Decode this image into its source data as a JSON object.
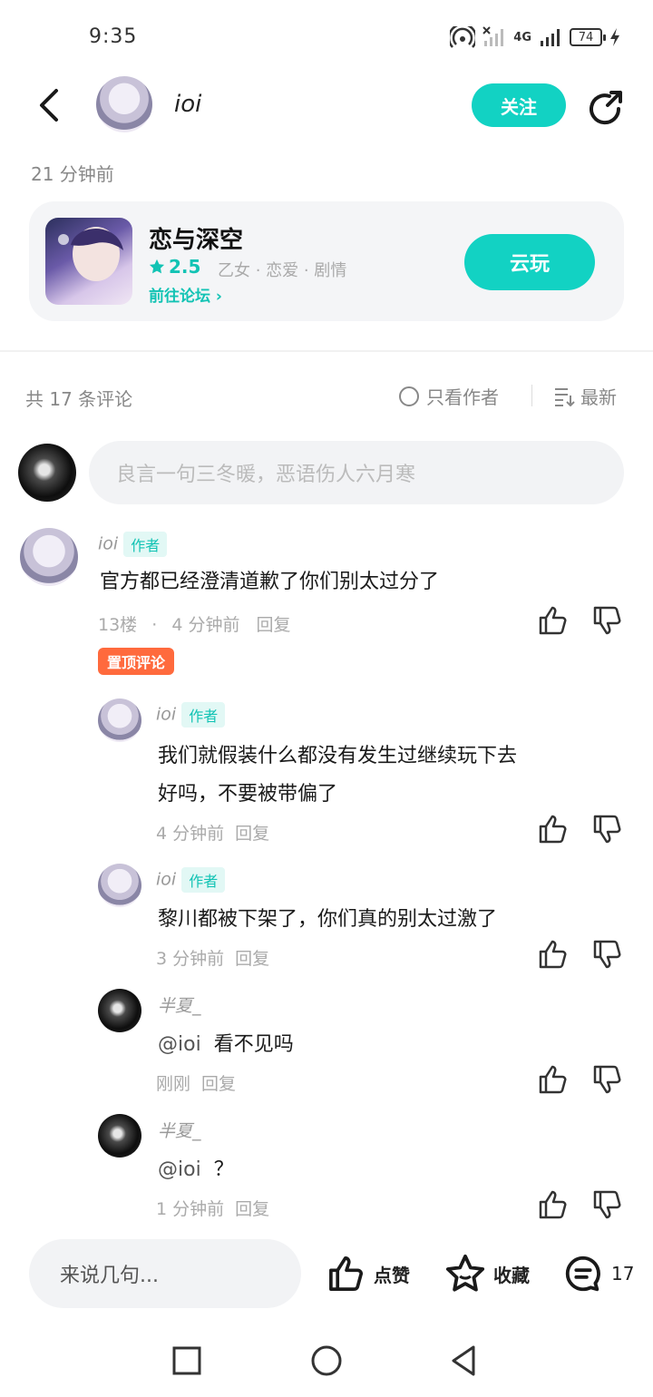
{
  "status": {
    "time": "9:35",
    "network": "4G",
    "battery": "74"
  },
  "header": {
    "user_name": "ioi",
    "follow_label": "关注"
  },
  "post": {
    "time": "21 分钟前"
  },
  "game": {
    "name": "恋与深空",
    "rating": "2.5",
    "tags": "乙女 · 恋爱 · 剧情",
    "forum_link": "前往论坛",
    "play_label": "云玩"
  },
  "comments_header": {
    "count": "共 17 条评论",
    "author_only": "只看作者",
    "sort": "最新"
  },
  "input": {
    "placeholder": "良言一句三冬暖，恶语伤人六月寒"
  },
  "author_tag": "作者",
  "top_comment": {
    "name": "ioi",
    "text": "官方都已经澄清道歉了你们别太过分了",
    "floor": "13楼",
    "dot": "·",
    "time": "4 分钟前",
    "reply": "回复",
    "pin_label": "置顶评论"
  },
  "replies": [
    {
      "name": "ioi",
      "is_author": true,
      "text_line1": "我们就假装什么都没有发生过继续玩下去",
      "text_line2": "好吗，不要被带偏了",
      "time": "4 分钟前",
      "reply": "回复"
    },
    {
      "name": "ioi",
      "is_author": true,
      "text": "黎川都被下架了，你们真的别太过激了",
      "time": "3 分钟前",
      "reply": "回复"
    },
    {
      "name": "半夏_",
      "is_author": false,
      "mention": "@ioi",
      "text": "看不见吗",
      "time": "刚刚",
      "reply": "回复"
    },
    {
      "name": "半夏_",
      "is_author": false,
      "mention": "@ioi",
      "text": "？",
      "time": "1 分钟前",
      "reply": "回复"
    }
  ],
  "bottom": {
    "input_placeholder": "来说几句...",
    "like_label": "点赞",
    "fav_label": "收藏",
    "comment_count": "17"
  },
  "colors": {
    "accent": "#12d2c3",
    "pin": "#ff6a3d"
  }
}
